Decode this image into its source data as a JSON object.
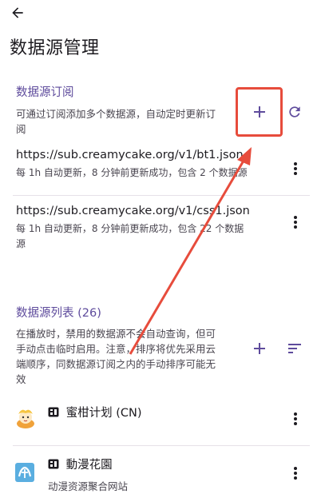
{
  "page": {
    "title": "数据源管理"
  },
  "subscriptions": {
    "section_title": "数据源订阅",
    "description_line1": "可通过订阅添加多个数据源，自动定时更新订",
    "description_line2": "阅",
    "items": [
      {
        "url": "https://sub.creamycake.org/v1/bt1.json",
        "meta_line1": "每 1h 自动更新，8 分钟前更新成功，包含 2 个数据源",
        "meta_line2": ""
      },
      {
        "url": "https://sub.creamycake.org/v1/css1.json",
        "meta_line1": "每 1h 自动更新，8 分钟前更新成功，包含 22 个数据",
        "meta_line2": "源"
      }
    ]
  },
  "sources": {
    "section_title": "数据源列表 (26)",
    "description_line1": "在播放时，禁用的数据源不会自动查询，但可",
    "description_line2": "手动点击临时启用。注意，排序将优先采用云",
    "description_line3": "端顺序，同数据源订阅之内的手动排序可能无",
    "description_line4": "效",
    "items": [
      {
        "name": "蜜柑计划 (CN)",
        "description": ""
      },
      {
        "name": "動漫花園",
        "description": "动漫资源聚合网站"
      }
    ]
  },
  "colors": {
    "accent": "#5e4b9c",
    "annotation": "#e74c3c"
  },
  "icons": {
    "back": "arrow-left-icon",
    "add": "plus-icon",
    "refresh": "refresh-icon",
    "more": "more-vert-icon",
    "sort": "sort-icon",
    "badge": "source-type-badge-icon"
  }
}
